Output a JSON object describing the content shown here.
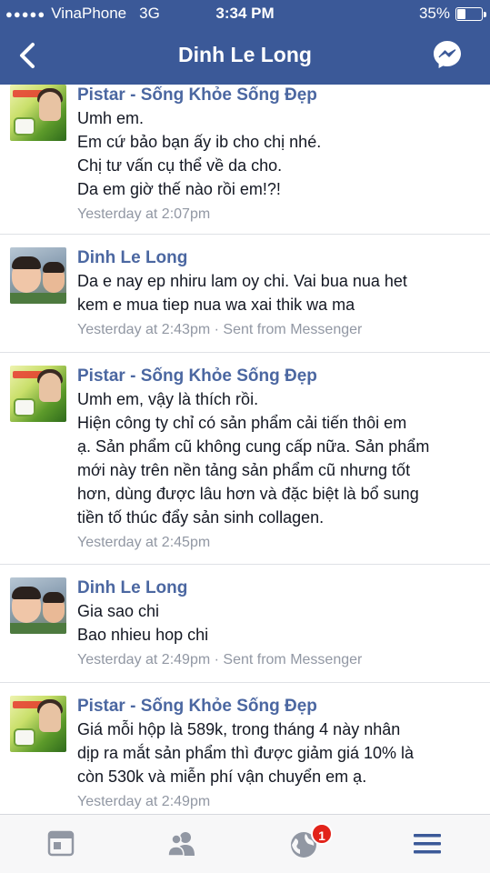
{
  "status_bar": {
    "carrier": "VinaPhone",
    "network": "3G",
    "time": "3:34 PM",
    "battery_percent": "35%",
    "battery_level": 0.35
  },
  "nav": {
    "title": "Dinh Le Long",
    "back_icon": "chevron-left-icon",
    "messenger_icon": "messenger-icon"
  },
  "messages": [
    {
      "sender": "Pistar - Sống Khỏe Sống Đẹp",
      "lines": [
        "Umh em.",
        "Em cứ bảo bạn ấy ib cho chị nhé.",
        "Chị tư vấn cụ thể về da cho.",
        "Da em giờ thế nào rồi em!?!"
      ],
      "meta": "Yesterday at 2:07pm"
    },
    {
      "sender": "Dinh Le Long",
      "lines": [
        "Da e nay ep nhiru lam oy chi. Vai bua nua het",
        "kem e mua tiep nua wa xai thik wa ma"
      ],
      "meta": "Yesterday at 2:43pm · Sent from Messenger"
    },
    {
      "sender": "Pistar - Sống Khỏe Sống Đẹp",
      "lines": [
        "Umh em, vậy là thích rồi.",
        "Hiện công ty chỉ có sản phẩm cải tiến thôi em",
        "ạ. Sản phẩm cũ không cung cấp nữa. Sản phẩm",
        "mới này trên nền tảng sản phẩm cũ nhưng tốt",
        "hơn, dùng được lâu hơn và đặc biệt là bổ sung",
        "tiền tố thúc đẩy sản sinh collagen."
      ],
      "meta": "Yesterday at 2:45pm"
    },
    {
      "sender": "Dinh Le Long",
      "lines": [
        "Gia sao chi",
        "Bao nhieu hop chi"
      ],
      "meta": "Yesterday at 2:49pm · Sent from Messenger"
    },
    {
      "sender": "Pistar - Sống Khỏe Sống Đẹp",
      "lines": [
        "Giá mỗi hộp là 589k, trong tháng 4 này nhân",
        "dịp ra mắt sản phẩm thì được giảm giá 10% là",
        "còn 530k và miễn phí vận chuyển em ạ."
      ],
      "meta": "Yesterday at 2:49pm"
    }
  ],
  "tab_bar": {
    "items": [
      "news-feed-icon",
      "friends-icon",
      "globe-icon",
      "menu-icon"
    ],
    "notification_count": "1"
  }
}
